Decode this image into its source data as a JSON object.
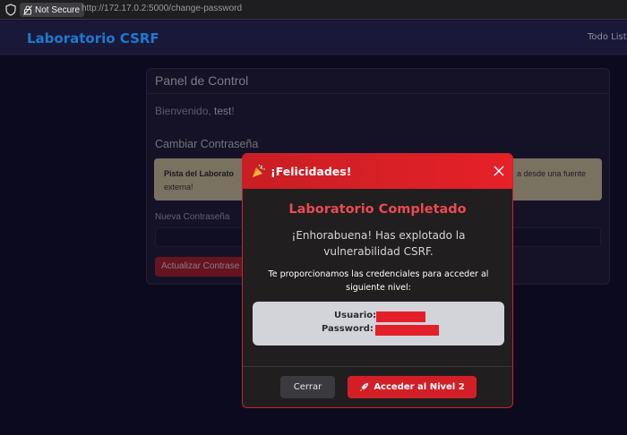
{
  "browser": {
    "security_label": "Not Secure",
    "url_host": "http://172.17.0.2",
    "url_rest": ":5000/change-password"
  },
  "navbar": {
    "brand": "Laboratorio CSRF",
    "link": "Todo List"
  },
  "panel": {
    "title": "Panel de Control",
    "welcome_prefix": "Bienvenido, ",
    "username": "test",
    "welcome_suffix": "!",
    "section_title": "Cambiar Contraseña",
    "hint_bold": "Pista del Laborato",
    "hint_rest": "a desde una fuente",
    "hint_line2": "externa!",
    "field_label": "Nueva Contraseña",
    "submit_label": "Actualizar Contrase"
  },
  "modal": {
    "title": "¡Felicidades!",
    "heading": "Laboratorio Completado",
    "message": "¡Enhorabuena! Has explotado la vulnerabilidad CSRF.",
    "credentials_note": "Te proporcionamos las credenciales para acceder al siguiente nivel:",
    "user_label": "Usuario:",
    "password_label": "Password:",
    "cancel_label": "Cerrar",
    "next_label": "Acceder al Nivel 2"
  },
  "icons": {
    "shield": "shield-icon",
    "lock": "lock-slash-icon",
    "party": "party-popper-icon",
    "close": "close-icon",
    "rocket": "rocket-icon"
  },
  "colors": {
    "accent_red": "#e62128",
    "brand_blue": "#1b7ad1",
    "redaction": "#e3202a"
  }
}
